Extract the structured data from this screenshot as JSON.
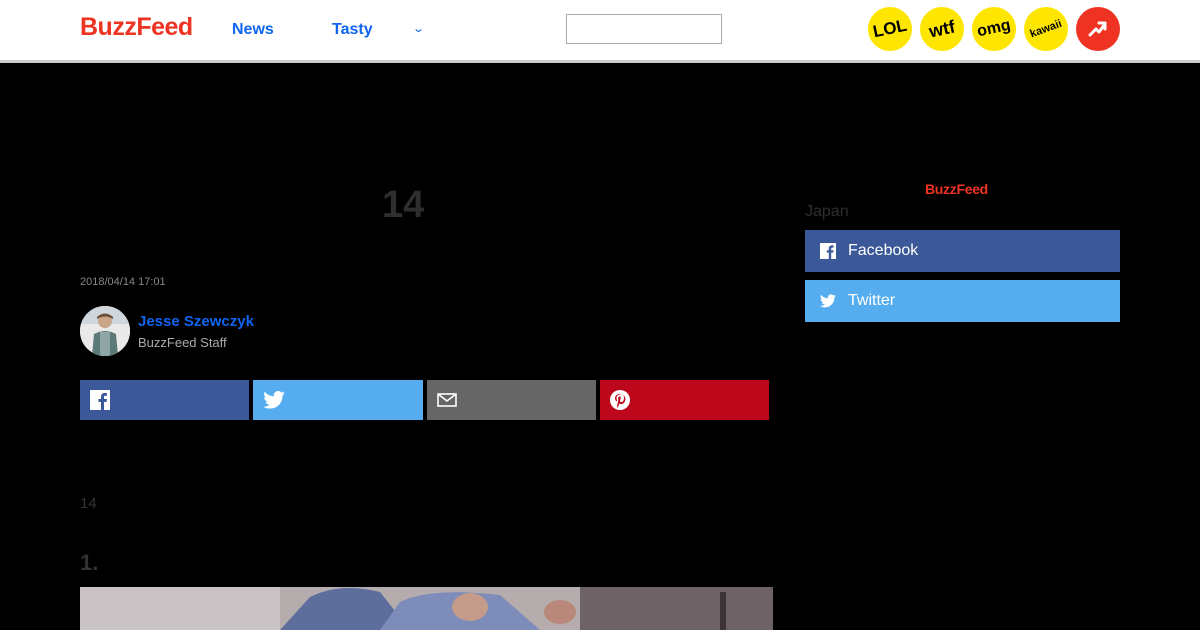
{
  "header": {
    "logo": "BuzzFeed",
    "nav": [
      "News",
      "Tasty"
    ],
    "chevron": "⌄",
    "search_placeholder": "",
    "badges": [
      "LOL",
      "wtf",
      "omg",
      "kawaii"
    ],
    "trending_icon": "trending-arrow-icon"
  },
  "article": {
    "count": "14",
    "date": "2018/04/14 17:01",
    "author": "Jesse Szewczyk",
    "role": "BuzzFeed Staff",
    "share_icons": [
      "facebook-icon",
      "twitter-icon",
      "mail-icon",
      "pinterest-icon"
    ],
    "body_count": "14",
    "item_number": "1."
  },
  "sidebar": {
    "logo": "BuzzFeed",
    "region": "Japan",
    "buttons": [
      {
        "label": "Facebook",
        "icon": "facebook-icon"
      },
      {
        "label": "Twitter",
        "icon": "twitter-icon"
      }
    ]
  },
  "colors": {
    "brand_red": "#ee3322",
    "link_blue": "#0f65ef",
    "facebook": "#3b5998",
    "twitter": "#55acee",
    "mail": "#666666",
    "pinterest": "#bd081c",
    "badge_yellow": "#fee600"
  }
}
